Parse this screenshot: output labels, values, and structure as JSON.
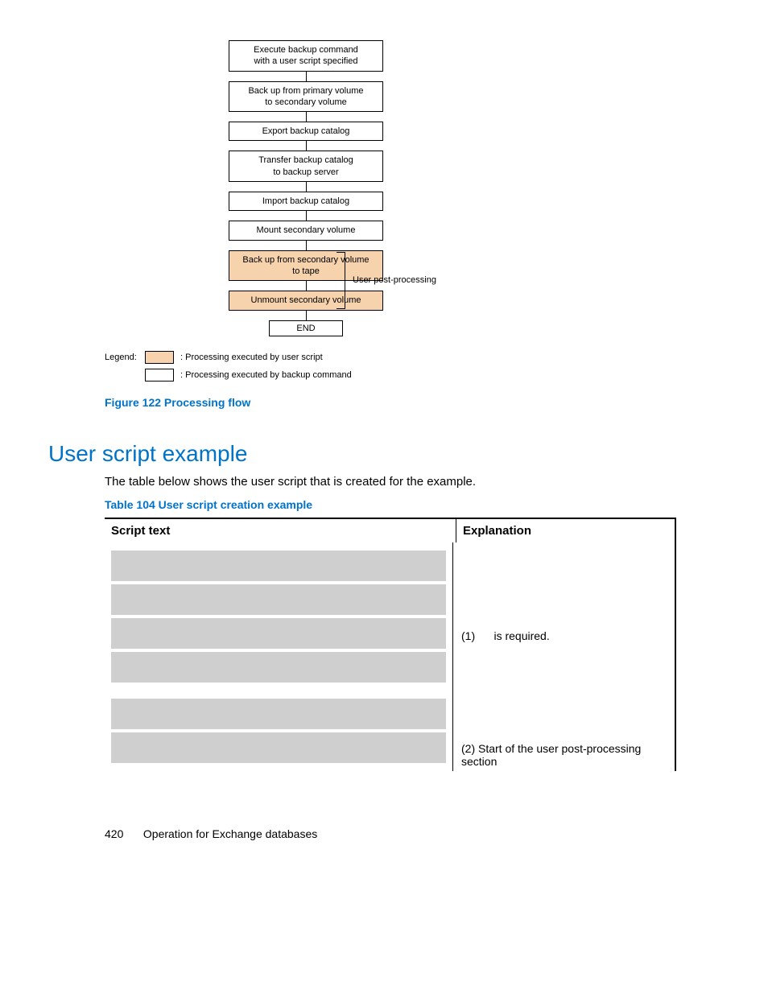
{
  "flow": {
    "steps": [
      "Execute backup command\nwith a user script specified",
      "Back up from primary volume\nto secondary volume",
      "Export backup catalog",
      "Transfer backup catalog\nto backup server",
      "Import backup catalog",
      "Mount secondary volume",
      "Back up from secondary volume\nto tape",
      "Unmount secondary volume"
    ],
    "end": "END",
    "bracket_label": "User post-processing"
  },
  "legend": {
    "label": "Legend:",
    "row1": ": Processing executed by user script",
    "row2": ": Processing executed by backup command"
  },
  "figure_caption": "Figure 122 Processing flow",
  "section_heading": "User script example",
  "intro_text": "The table below shows the user script that is created for the example.",
  "table_caption": "Table 104 User script creation example",
  "table": {
    "head_left": "Script text",
    "head_right": "Explanation",
    "exp1_num": "(1)",
    "exp1_text": "is required.",
    "exp2": "(2) Start of the user post-processing section"
  },
  "footer": {
    "page": "420",
    "title": "Operation for Exchange databases"
  }
}
